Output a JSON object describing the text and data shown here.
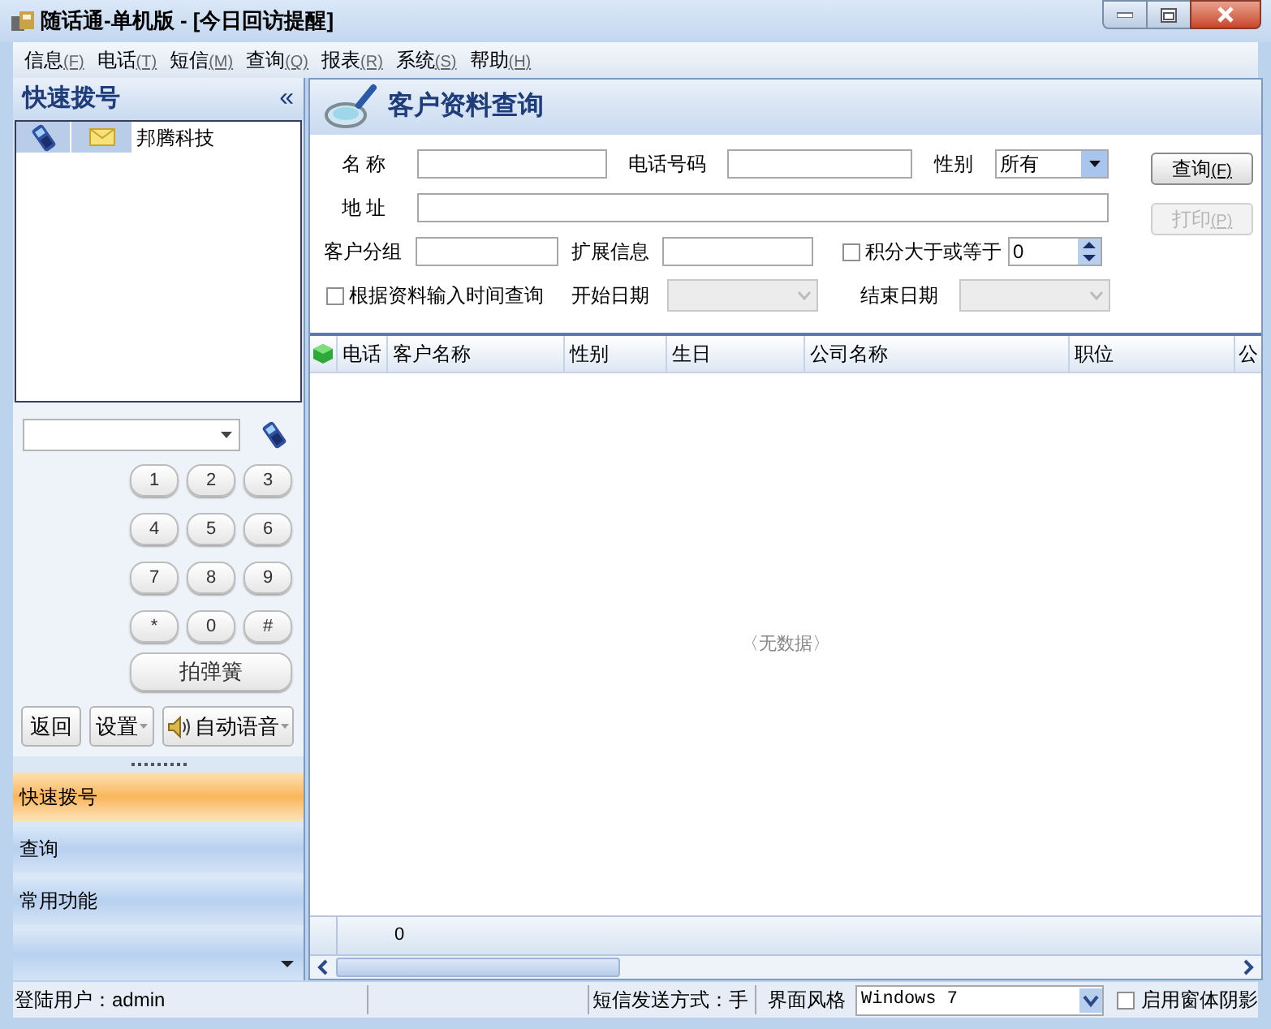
{
  "window": {
    "title": "随话通-单机版 - [今日回访提醒]"
  },
  "menu": [
    {
      "label": "信息",
      "accel": "(F)"
    },
    {
      "label": "电话",
      "accel": "(T)"
    },
    {
      "label": "短信",
      "accel": "(M)"
    },
    {
      "label": "查询",
      "accel": "(Q)"
    },
    {
      "label": "报表",
      "accel": "(R)"
    },
    {
      "label": "系统",
      "accel": "(S)"
    },
    {
      "label": "帮助",
      "accel": "(H)"
    }
  ],
  "sidebar": {
    "title": "快速拨号",
    "collapse": "«",
    "contacts": [
      {
        "name": "邦腾科技"
      }
    ],
    "keys": [
      "1",
      "2",
      "3",
      "4",
      "5",
      "6",
      "7",
      "8",
      "9",
      "*",
      "0",
      "#"
    ],
    "hook_button": "拍弹簧",
    "buttons": [
      {
        "label": "返回",
        "kind": "plain"
      },
      {
        "label": "设置",
        "kind": "dropdown"
      },
      {
        "label": "自动语音",
        "kind": "voice"
      }
    ],
    "nav": [
      {
        "label": "快速拨号",
        "selected": true
      },
      {
        "label": "查询",
        "selected": false
      },
      {
        "label": "常用功能",
        "selected": false
      }
    ]
  },
  "panel": {
    "title": "客户资料查询",
    "fields": {
      "name_label": "名 称",
      "phone_label": "电话号码",
      "gender_label": "性别",
      "gender_value": "所有",
      "address_label": "地 址",
      "group_label": "客户分组",
      "ext_label": "扩展信息",
      "points_label": "积分大于或等于",
      "points_value": "0",
      "points_checked": false,
      "date_query_label": "根据资料输入时间查询",
      "date_query_checked": false,
      "start_label": "开始日期",
      "end_label": "结束日期",
      "dates_disabled": true
    },
    "buttons": [
      {
        "label": "查询",
        "accel": "(F)",
        "disabled": false
      },
      {
        "label": "打印",
        "accel": "(P)",
        "disabled": true
      }
    ],
    "table": {
      "columns": [
        "电话",
        "客户名称",
        "性别",
        "生日",
        "公司名称",
        "职位",
        "公"
      ],
      "empty_text": "〈无数据〉",
      "footer": "0"
    }
  },
  "status_bar": {
    "user": "登陆用户：admin",
    "sms_mode": "短信发送方式：手",
    "style_label": "界面风格",
    "style_value": "Windows 7",
    "shadow_label": "启用窗体阴影",
    "shadow_checked": false
  }
}
